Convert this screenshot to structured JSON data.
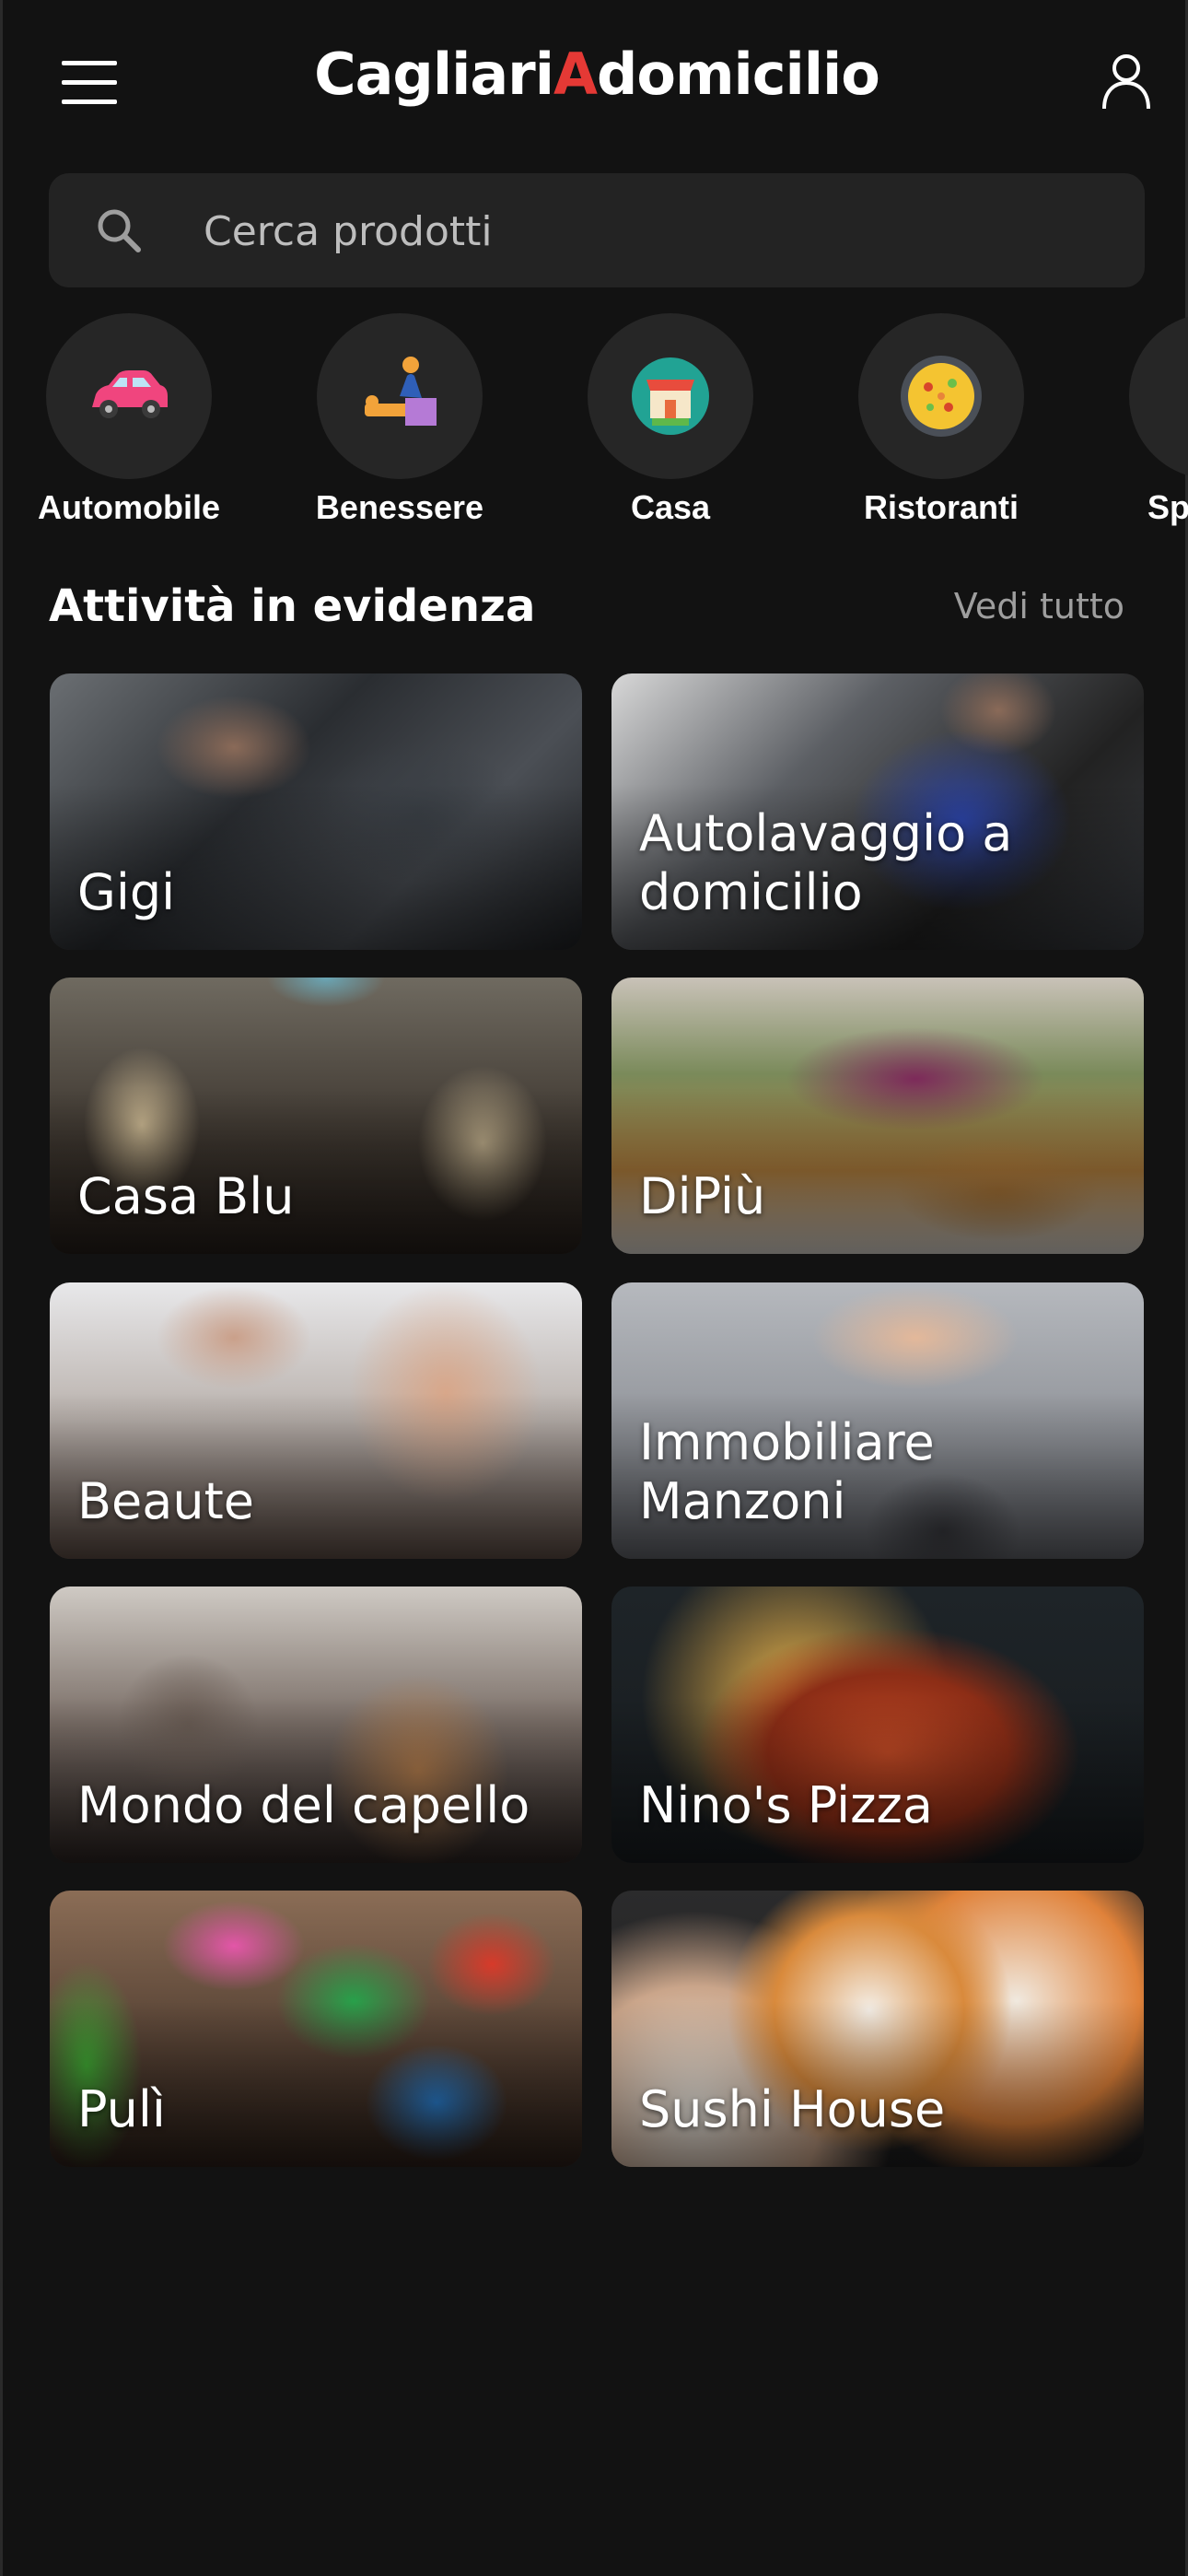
{
  "header": {
    "logo_part1": "Cagliari",
    "logo_accent": "A",
    "logo_part2": "domicilio",
    "menu_icon": "hamburger-icon",
    "user_icon": "user-icon"
  },
  "search": {
    "placeholder": "Cerca prodotti",
    "icon": "search-icon"
  },
  "categories": [
    {
      "label": "Automobile",
      "icon": "car-icon"
    },
    {
      "label": "Benessere",
      "icon": "massage-icon"
    },
    {
      "label": "Casa",
      "icon": "shop-icon"
    },
    {
      "label": "Ristoranti",
      "icon": "paella-icon"
    },
    {
      "label": "Sp",
      "icon": "partial-icon"
    }
  ],
  "featured": {
    "title": "Attività in evidenza",
    "see_all": "Vedi tutto",
    "items": [
      {
        "name": "Gigi"
      },
      {
        "name": "Autolavaggio a domicilio"
      },
      {
        "name": "Casa Blu"
      },
      {
        "name": "DiPiù"
      },
      {
        "name": "Beaute"
      },
      {
        "name": "Immobiliare Manzoni"
      },
      {
        "name": "Mondo del capello"
      },
      {
        "name": "Nino's Pizza"
      },
      {
        "name": "Pulì"
      },
      {
        "name": "Sushi House"
      }
    ]
  },
  "colors": {
    "background": "#121212",
    "accent": "#e53935",
    "search_bg": "#232323",
    "category_circle": "#262626"
  }
}
